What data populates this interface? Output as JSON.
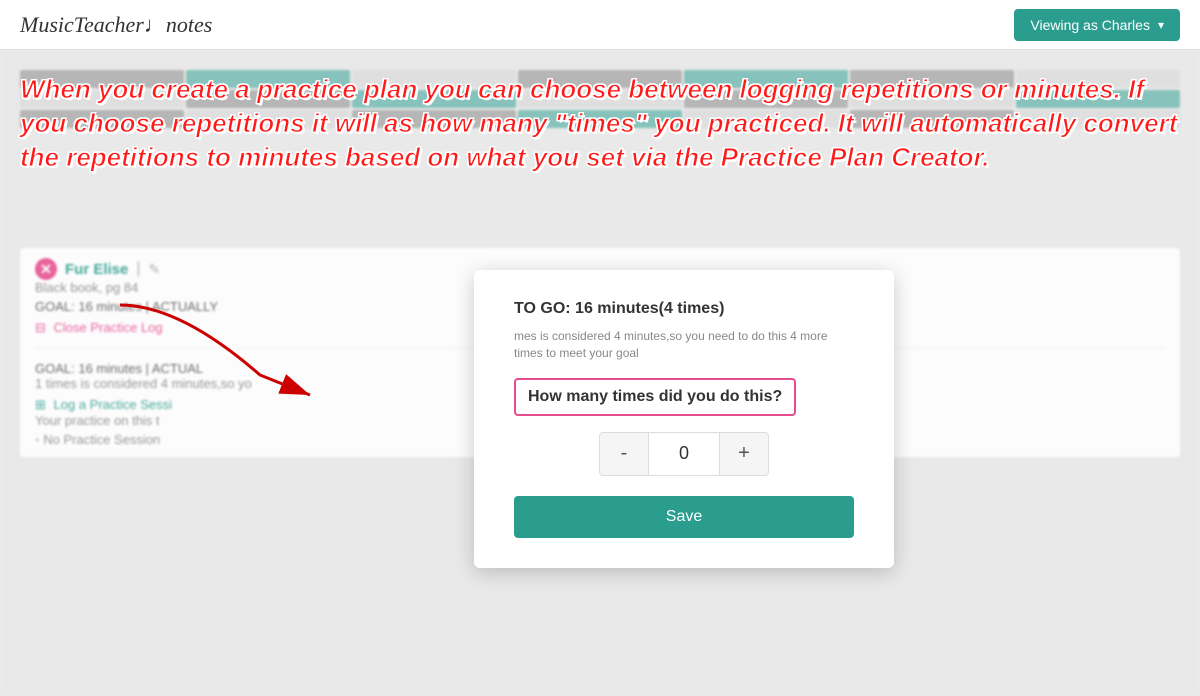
{
  "header": {
    "logo": "MusicTeacher♩notes",
    "viewing_as_label": "Viewing as Charles"
  },
  "annotation": {
    "text": "When you create a practice plan you can choose between logging repetitions or minutes. If you choose repetitions it will as how many \"times\" you practiced. It will automatically convert the repetitions to minutes based on what you set via the Practice Plan Creator."
  },
  "background": {
    "item": {
      "title": "Fur Elise",
      "subtitle": "Black book, pg 84",
      "goal": "GOAL: 16 minutes | ACTUALLY",
      "close_log": "Close Practice Log",
      "goal2": "GOAL: 16 minutes | ACTUAL",
      "note2": "1 times is considered 4 minutes,so yo",
      "log_session": "Log a Practice Sessi",
      "your_practice": "Your practice on this t",
      "no_session": "No Practice Session"
    }
  },
  "modal": {
    "to_go_label": "TO GO: 16 minutes(4 times)",
    "note": "mes is considered 4 minutes,so you need to do this 4 more times to meet your goal",
    "question": "How many times did you do this?",
    "stepper": {
      "minus_label": "-",
      "value": "0",
      "plus_label": "+"
    },
    "save_label": "Save"
  }
}
